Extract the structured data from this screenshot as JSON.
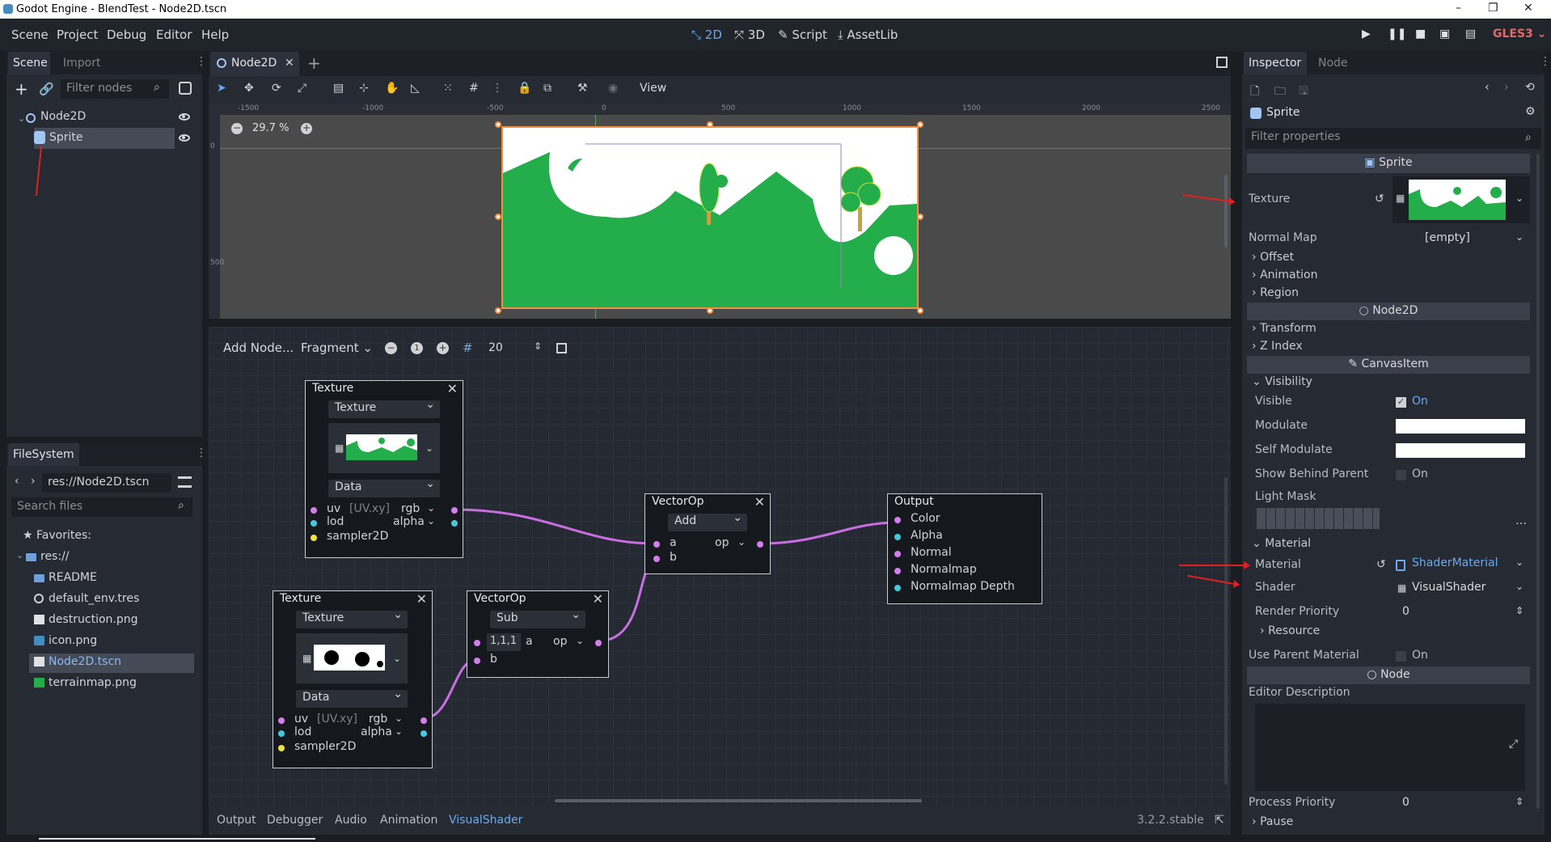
{
  "window": {
    "title": "Godot Engine - BlendTest - Node2D.tscn",
    "minimize": "–",
    "maximize": "❐",
    "close": "✕"
  },
  "menu": {
    "items": [
      "Scene",
      "Project",
      "Debug",
      "Editor",
      "Help"
    ]
  },
  "modes": {
    "m2d": "2D",
    "m3d": "3D",
    "script": "Script",
    "assetlib": "AssetLib",
    "renderer": "GLES3"
  },
  "scene_dock": {
    "tab_scene": "Scene",
    "tab_import": "Import",
    "filter_placeholder": "Filter nodes",
    "root": "Node2D",
    "child": "Sprite"
  },
  "filesystem": {
    "tab": "FileSystem",
    "path": "res://Node2D.tscn",
    "search_placeholder": "Search files",
    "favorites": "Favorites:",
    "root": "res://",
    "items": [
      "README",
      "default_env.tres",
      "destruction.png",
      "icon.png",
      "Node2D.tscn",
      "terrainmap.png"
    ]
  },
  "editor_tab": {
    "name": "Node2D",
    "plus": "+"
  },
  "toolbar2d": {
    "view": "View",
    "zoom": "29.7 %"
  },
  "ruler": {
    "h": [
      "-1500",
      "-1000",
      "-500",
      "0",
      "500",
      "1000",
      "1500",
      "2000",
      "2500"
    ],
    "v": [
      "0",
      "500"
    ]
  },
  "shader_editor": {
    "add_node": "Add Node...",
    "mode": "Fragment",
    "snap": "20"
  },
  "nodes": {
    "tex1": {
      "title": "Texture",
      "source": "Texture",
      "type": "Data",
      "uv": "uv",
      "uv_default": "[UV.xy]",
      "rgb": "rgb",
      "lod": "lod",
      "alpha": "alpha",
      "sampler": "sampler2D"
    },
    "tex2": {
      "title": "Texture",
      "source": "Texture",
      "type": "Data",
      "uv": "uv",
      "uv_default": "[UV.xy]",
      "rgb": "rgb",
      "lod": "lod",
      "alpha": "alpha",
      "sampler": "sampler2D"
    },
    "vecop_add": {
      "title": "VectorOp",
      "op": "Add",
      "a": "a",
      "b": "b",
      "out": "op"
    },
    "vecop_sub": {
      "title": "VectorOp",
      "op": "Sub",
      "a_val": "1,1,1",
      "a": "a",
      "b": "b",
      "out": "op"
    },
    "output": {
      "title": "Output",
      "ports": [
        "Color",
        "Alpha",
        "Normal",
        "Normalmap",
        "Normalmap Depth"
      ]
    }
  },
  "bottom_tabs": {
    "items": [
      "Output",
      "Debugger",
      "Audio",
      "Animation",
      "VisualShader"
    ],
    "version": "3.2.2.stable"
  },
  "inspector": {
    "tab_inspector": "Inspector",
    "tab_node": "Node",
    "object": "Sprite",
    "filter_placeholder": "Filter properties",
    "sprite_section": "Sprite",
    "texture_label": "Texture",
    "normal_map_label": "Normal Map",
    "normal_map_value": "[empty]",
    "groups1": [
      "Offset",
      "Animation",
      "Region"
    ],
    "node2d_section": "Node2D",
    "groups2": [
      "Transform",
      "Z Index"
    ],
    "canvasitem_section": "CanvasItem",
    "visibility": "Visibility",
    "visible_label": "Visible",
    "visible_value": "On",
    "modulate": "Modulate",
    "self_modulate": "Self Modulate",
    "show_behind": "Show Behind Parent",
    "show_behind_value": "On",
    "light_mask": "Light Mask",
    "material_group": "Material",
    "material_label": "Material",
    "material_value": "ShaderMaterial",
    "shader_label": "Shader",
    "shader_value": "VisualShader",
    "render_priority": "Render Priority",
    "render_priority_value": "0",
    "resource": "Resource",
    "use_parent": "Use Parent Material",
    "use_parent_value": "On",
    "node_section": "Node",
    "editor_desc": "Editor Description",
    "process_priority": "Process Priority",
    "process_priority_value": "0",
    "pause": "Pause"
  },
  "colors": {
    "accent": "#6aaaf0",
    "grass": "#23ad4b",
    "port_vec": "#d67dee",
    "port_scalar": "#48c8e0",
    "port_sampler": "#f0e040",
    "wire": "#c86ee0"
  }
}
